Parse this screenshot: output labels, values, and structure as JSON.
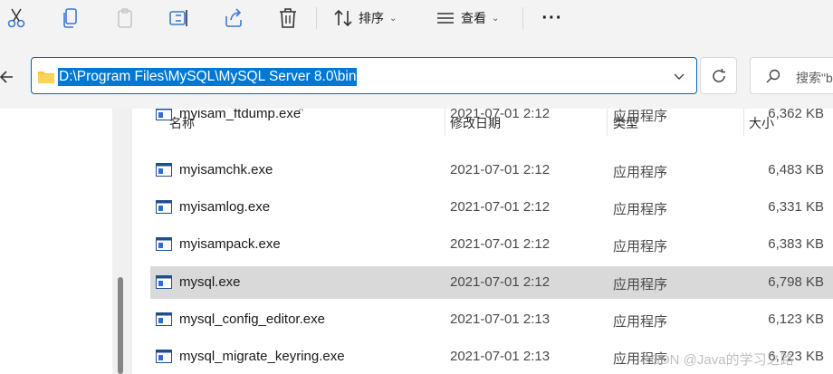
{
  "toolbar": {
    "sort_label": "排序",
    "view_label": "查看",
    "more_label": "···"
  },
  "address_bar": {
    "path": "D:\\Program Files\\MySQL\\MySQL Server 8.0\\bin"
  },
  "search": {
    "placeholder": "搜索\"b"
  },
  "columns": {
    "name": "名称",
    "date": "修改日期",
    "type": "类型",
    "size": "大小"
  },
  "files": [
    {
      "name": "myisam_ftdump.exe",
      "date": "2021-07-01 2:12",
      "type": "应用程序",
      "size": "6,362 KB"
    },
    {
      "name": "myisamchk.exe",
      "date": "2021-07-01 2:12",
      "type": "应用程序",
      "size": "6,483 KB"
    },
    {
      "name": "myisamlog.exe",
      "date": "2021-07-01 2:12",
      "type": "应用程序",
      "size": "6,331 KB"
    },
    {
      "name": "myisampack.exe",
      "date": "2021-07-01 2:12",
      "type": "应用程序",
      "size": "6,383 KB"
    },
    {
      "name": "mysql.exe",
      "date": "2021-07-01 2:12",
      "type": "应用程序",
      "size": "6,798 KB",
      "selected": true
    },
    {
      "name": "mysql_config_editor.exe",
      "date": "2021-07-01 2:13",
      "type": "应用程序",
      "size": "6,123 KB"
    },
    {
      "name": "mysql_migrate_keyring.exe",
      "date": "2021-07-01 2:13",
      "type": "应用程序",
      "size": "6,723 KB"
    }
  ],
  "watermark": "CSDN @Java的学习之路",
  "colors": {
    "accent": "#0078d4",
    "selected_row": "#d9d9d9",
    "toolbar_bg": "#f3f3f3"
  }
}
